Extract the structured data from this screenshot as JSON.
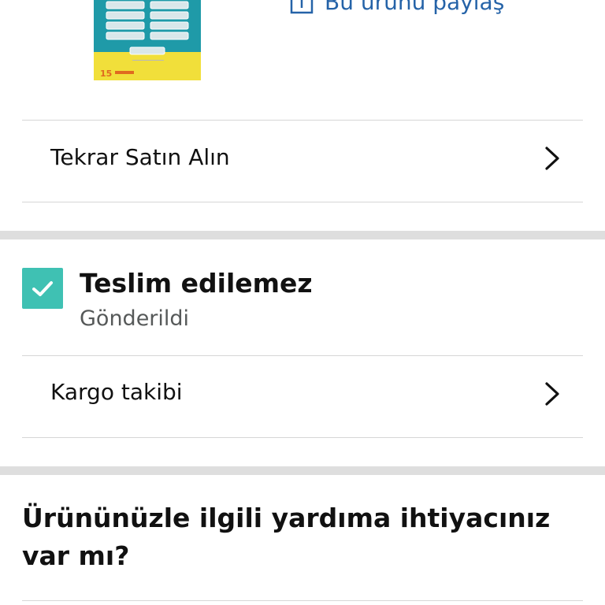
{
  "product": {
    "image_pack_count": "15",
    "share_label": "Bu ürünü paylaş"
  },
  "actions": {
    "buy_again_label": "Tekrar Satın Alın"
  },
  "shipment": {
    "status_title": "Teslim edilemez",
    "status_subtitle": "Gönderildi",
    "track_label": "Kargo takibi"
  },
  "help": {
    "heading": "Ürününüzle ilgili yardıma ihtiyacınız var mı?"
  },
  "colors": {
    "link": "#2563a8",
    "check_badge": "#3fc1b3",
    "divider": "#d6d6d6",
    "section_gap": "#dedede",
    "subtitle": "#565959"
  },
  "icons": {
    "share": "share-icon",
    "chevron": "chevron-right-icon",
    "status": "checkmark-icon"
  }
}
